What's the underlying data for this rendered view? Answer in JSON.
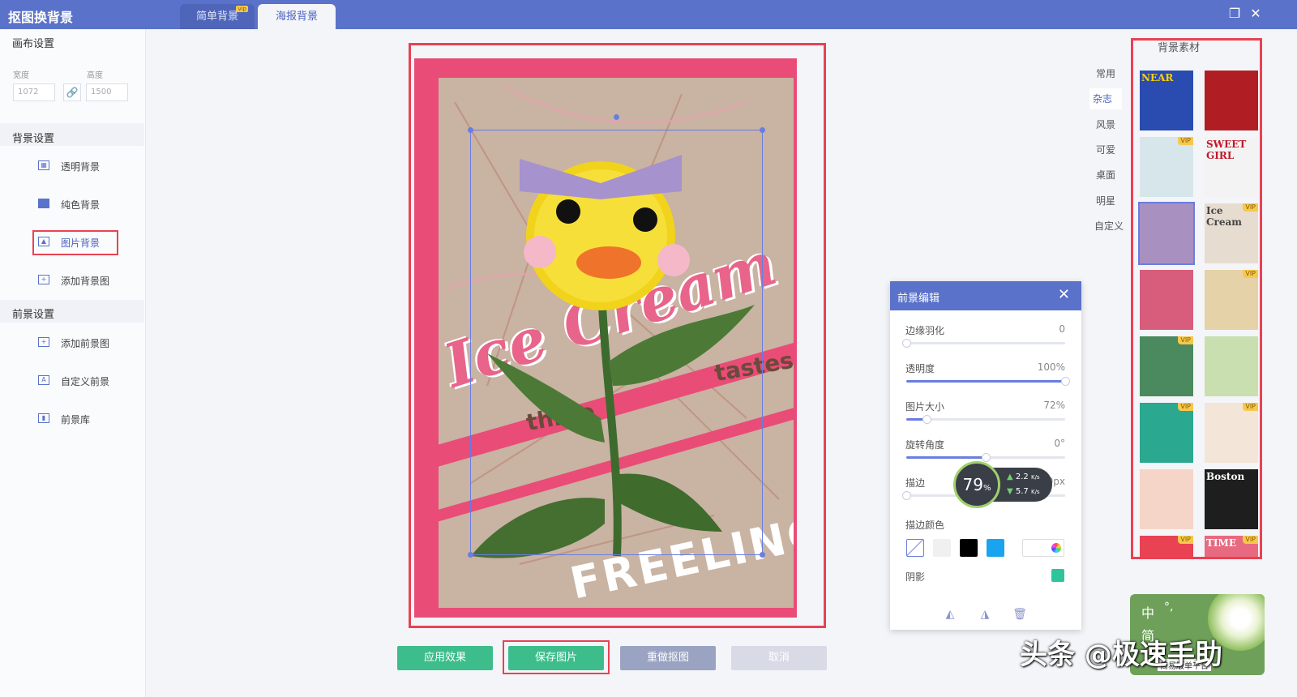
{
  "app": {
    "title": "抠图换背景"
  },
  "tabs": [
    {
      "label": "简单背景",
      "badge": "vip"
    },
    {
      "label": "海报背景"
    }
  ],
  "left": {
    "canvas_title": "画布设置",
    "width_label": "宽度",
    "height_label": "高度",
    "width_value": "1072",
    "height_value": "1500",
    "bg_title": "背景设置",
    "bg_items": [
      "透明背景",
      "纯色背景",
      "图片背景",
      "添加背景图"
    ],
    "fg_title": "前景设置",
    "fg_items": [
      "添加前景图",
      "自定义前景",
      "前景库"
    ]
  },
  "poster": {
    "headline": "Ice Cream",
    "line1": "three",
    "line2": "tastes",
    "bottom": "FREELING"
  },
  "buttons": {
    "apply": "应用效果",
    "save": "保存图片",
    "redo": "重做抠图",
    "cancel": "取消"
  },
  "categories": [
    "常用",
    "杂志",
    "风景",
    "可爱",
    "桌面",
    "明星",
    "自定义"
  ],
  "materials": {
    "title": "背景素材",
    "thumbs": [
      {
        "vip": "",
        "text": "NEAR"
      },
      {
        "vip": "",
        "text": ""
      },
      {
        "vip": "VIP",
        "text": ""
      },
      {
        "vip": "",
        "text": "SWEET GIRL"
      },
      {
        "vip": "",
        "text": ""
      },
      {
        "vip": "VIP",
        "text": "Ice Cream"
      },
      {
        "vip": "",
        "text": ""
      },
      {
        "vip": "VIP",
        "text": ""
      },
      {
        "vip": "VIP",
        "text": ""
      },
      {
        "vip": "",
        "text": ""
      },
      {
        "vip": "VIP",
        "text": ""
      },
      {
        "vip": "VIP",
        "text": ""
      },
      {
        "vip": "",
        "text": ""
      },
      {
        "vip": "",
        "text": "Boston"
      },
      {
        "vip": "VIP",
        "text": ""
      },
      {
        "vip": "VIP",
        "text": "TIME"
      }
    ]
  },
  "fg_panel": {
    "title": "前景编辑",
    "feather": {
      "label": "边缘羽化",
      "value": "0",
      "level": 0
    },
    "opacity": {
      "label": "透明度",
      "value": "100%",
      "level": 1
    },
    "size": {
      "label": "图片大小",
      "value": "72%",
      "level": 0.13
    },
    "rotate": {
      "label": "旋转角度",
      "value": "0°",
      "level": 0.5
    },
    "stroke": {
      "label": "描边",
      "value": "0px",
      "level": 0
    },
    "stroke_color_label": "描边颜色",
    "shadow_label": "阴影"
  },
  "speed": {
    "percent": "79",
    "unit": "%",
    "up": "2.2",
    "down": "5.7",
    "rate_unit": "K/s"
  },
  "watermark": "头条 @极速手助",
  "ime": {
    "lang": "中",
    "punct": "°,",
    "mode": "简",
    "hint": "简易版单平台"
  },
  "colors": {
    "titlebar": "#5a72c9",
    "highlight": "#e84253",
    "poster_pink": "#e94c77",
    "btn_green": "#3ebd8c",
    "btn_grey": "#9aa3c2",
    "shadow_swatch": "#2fc59b"
  }
}
